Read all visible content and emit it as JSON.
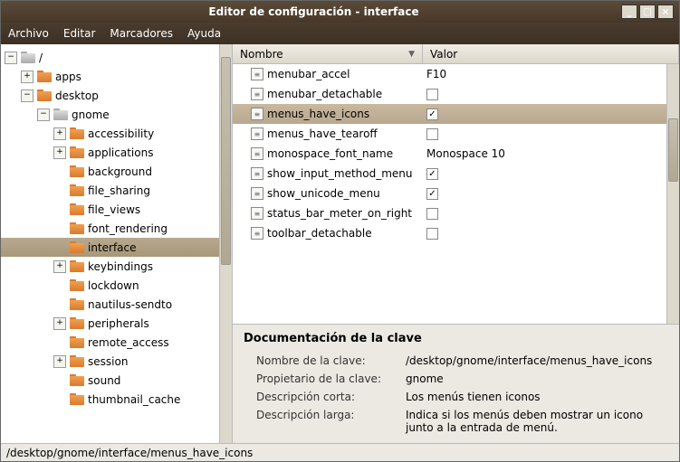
{
  "window": {
    "title": "Editor de configuración - interface"
  },
  "menubar": {
    "file": "Archivo",
    "edit": "Editar",
    "bookmarks": "Marcadores",
    "help": "Ayuda"
  },
  "tree": {
    "root": "/",
    "apps": "apps",
    "desktop": "desktop",
    "gnome": "gnome",
    "accessibility": "accessibility",
    "applications": "applications",
    "background": "background",
    "file_sharing": "file_sharing",
    "file_views": "file_views",
    "font_rendering": "font_rendering",
    "interface": "interface",
    "keybindings": "keybindings",
    "lockdown": "lockdown",
    "nautilus_sendto": "nautilus-sendto",
    "peripherals": "peripherals",
    "remote_access": "remote_access",
    "session": "session",
    "sound": "sound",
    "thumbnail_cache": "thumbnail_cache"
  },
  "columns": {
    "name": "Nombre",
    "value": "Valor"
  },
  "keys": [
    {
      "name": "menubar_accel",
      "value": "F10",
      "type": "string",
      "checked": false
    },
    {
      "name": "menubar_detachable",
      "value": "",
      "type": "bool",
      "checked": false
    },
    {
      "name": "menus_have_icons",
      "value": "",
      "type": "bool",
      "checked": true,
      "selected": true
    },
    {
      "name": "menus_have_tearoff",
      "value": "",
      "type": "bool",
      "checked": false
    },
    {
      "name": "monospace_font_name",
      "value": "Monospace 10",
      "type": "string",
      "checked": false
    },
    {
      "name": "show_input_method_menu",
      "value": "",
      "type": "bool",
      "checked": true
    },
    {
      "name": "show_unicode_menu",
      "value": "",
      "type": "bool",
      "checked": true
    },
    {
      "name": "status_bar_meter_on_right",
      "value": "",
      "type": "bool",
      "checked": false
    },
    {
      "name": "toolbar_detachable",
      "value": "",
      "type": "bool",
      "checked": false
    }
  ],
  "doc": {
    "heading": "Documentación de la clave",
    "key_name_label": "Nombre de la clave:",
    "key_name_value": "/desktop/gnome/interface/menus_have_icons",
    "owner_label": "Propietario de la clave:",
    "owner_value": "gnome",
    "short_label": "Descripción corta:",
    "short_value": "Los menús tienen iconos",
    "long_label": "Descripción larga:",
    "long_value": "Indica si los menús deben mostrar un icono junto a la entrada de menú."
  },
  "statusbar": {
    "path": "/desktop/gnome/interface/menus_have_icons"
  }
}
